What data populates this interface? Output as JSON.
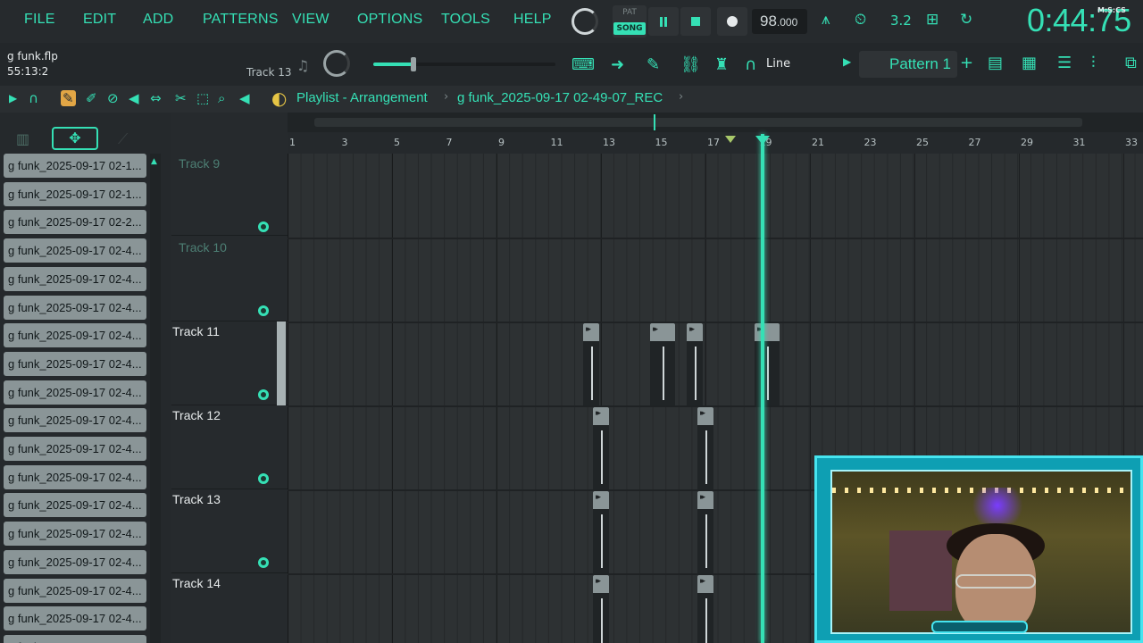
{
  "menu": [
    "FILE",
    "EDIT",
    "ADD",
    "PATTERNS",
    "VIEW",
    "OPTIONS",
    "TOOLS",
    "HELP"
  ],
  "transport": {
    "pat_label": "PAT",
    "song_label": "SONG",
    "tempo": "98",
    "tempo_decimal": ".000",
    "time": "0:44:75",
    "time_format": "M:S:CS",
    "cpu": "3.2"
  },
  "hint": {
    "project_name": "g funk.flp",
    "project_time": "55:13:2",
    "track": "Track 13"
  },
  "master": {
    "level": 0.22
  },
  "snap": "Line",
  "pattern": "Pattern 1",
  "playlist": {
    "title": "Playlist - Arrangement",
    "file": "g funk_2025-09-17 02-49-07_REC"
  },
  "browser_items": [
    "g funk_2025-09-17 02-1...",
    "g funk_2025-09-17 02-1...",
    "g funk_2025-09-17 02-2...",
    "g funk_2025-09-17 02-4...",
    "g funk_2025-09-17 02-4...",
    "g funk_2025-09-17 02-4...",
    "g funk_2025-09-17 02-4...",
    "g funk_2025-09-17 02-4...",
    "g funk_2025-09-17 02-4...",
    "g funk_2025-09-17 02-4...",
    "g funk_2025-09-17 02-4...",
    "g funk_2025-09-17 02-4...",
    "g funk_2025-09-17 02-4...",
    "g funk_2025-09-17 02-4...",
    "g funk_2025-09-17 02-4...",
    "g funk_2025-09-17 02-4...",
    "g funk_2025-09-17 02-4...",
    "g funk_2025-09-17 02-4..."
  ],
  "tracks": [
    "Track 9",
    "Track 10",
    "Track 11",
    "Track 12",
    "Track 13",
    "Track 14"
  ],
  "bar_numbers": [
    "1",
    "3",
    "5",
    "7",
    "9",
    "11",
    "13",
    "15",
    "17",
    "19",
    "21",
    "23",
    "25",
    "27",
    "29",
    "31",
    "33"
  ]
}
